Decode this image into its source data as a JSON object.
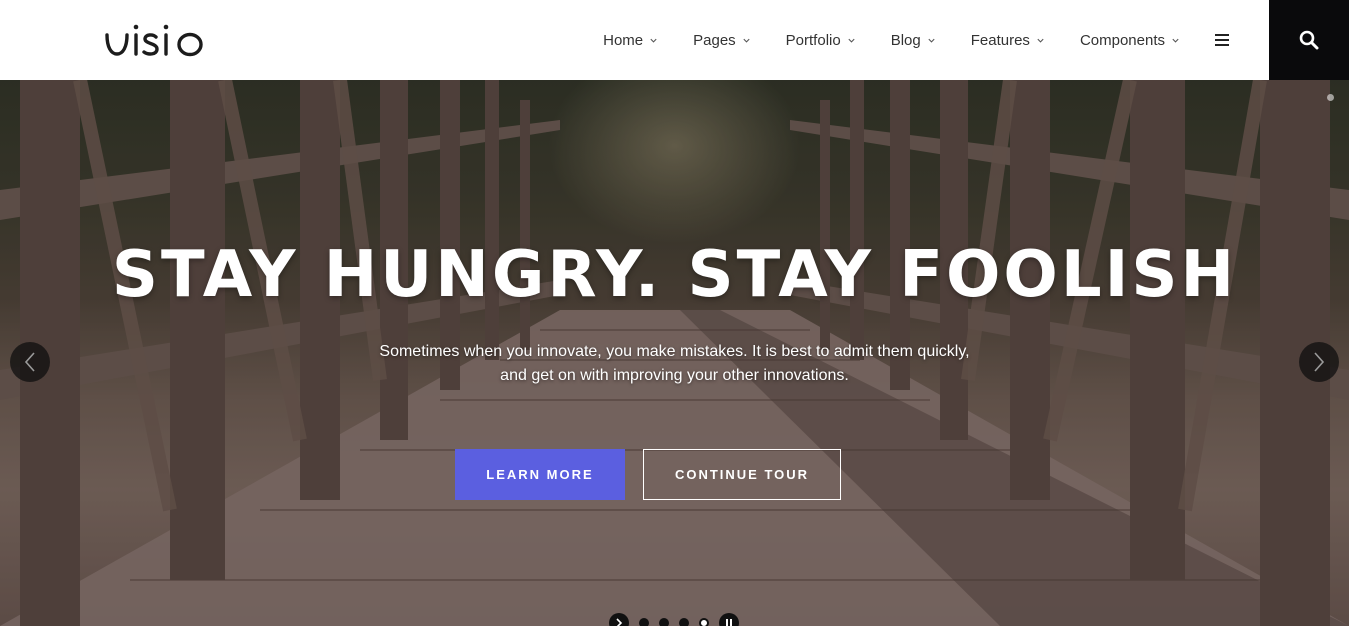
{
  "header": {
    "logo_text": "visio",
    "nav": [
      {
        "label": "Home",
        "icon": "chevron-down-icon"
      },
      {
        "label": "Pages",
        "icon": "chevron-down-icon"
      },
      {
        "label": "Portfolio",
        "icon": "chevron-down-icon"
      },
      {
        "label": "Blog",
        "icon": "chevron-down-icon"
      },
      {
        "label": "Features",
        "icon": "chevron-down-icon"
      },
      {
        "label": "Components",
        "icon": "chevron-down-icon"
      }
    ],
    "menu_icon": "hamburger-icon",
    "search_icon": "search-icon"
  },
  "hero": {
    "title": "STAY HUNGRY. STAY FOOLISH",
    "subtitle_line1": "Sometimes when you innovate, you make mistakes. It is best to admit them quickly,",
    "subtitle_line2": "and get on with improving your other innovations.",
    "primary_button": "LEARN MORE",
    "secondary_button": "CONTINUE TOUR",
    "prev_icon": "chevron-left-icon",
    "next_icon": "chevron-right-icon",
    "slide_count": 4,
    "active_slide": 4
  },
  "colors": {
    "accent": "#5b5fe0",
    "search_bg": "#0a0a0c",
    "text_dark": "#333333"
  }
}
